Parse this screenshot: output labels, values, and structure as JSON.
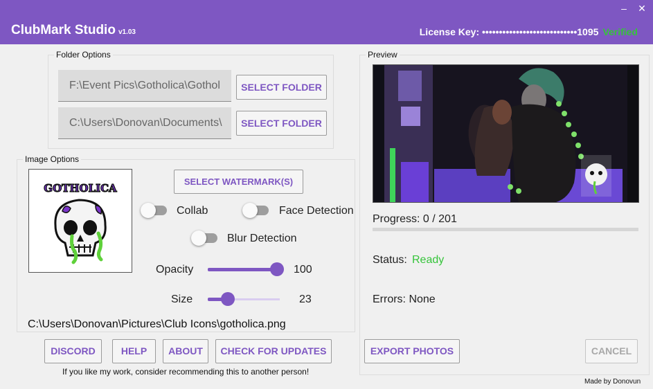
{
  "window": {
    "title": "ClubMark Studio",
    "version": "v1.03",
    "minimize_glyph": "–",
    "close_glyph": "✕",
    "license_label": "License Key:",
    "license_value": "••••••••••••••••••••••••••••1095",
    "license_status": "Verified",
    "accent_color": "#7e57c2",
    "verified_color": "#35c43a"
  },
  "folder_options": {
    "label": "Folder Options",
    "input_path": "F:\\Event Pics\\Gotholica\\Gothol",
    "output_path": "C:\\Users\\Donovan\\Documents\\",
    "select_folder_label": "SELECT FOLDER"
  },
  "image_options": {
    "label": "Image Options",
    "select_watermark_label": "SELECT WATERMARK(S)",
    "collab_label": "Collab",
    "collab_on": false,
    "face_detection_label": "Face Detection",
    "face_detection_on": false,
    "blur_detection_label": "Blur Detection",
    "blur_detection_on": false,
    "opacity_label": "Opacity",
    "opacity_value": "100",
    "opacity_fraction": 1.0,
    "size_label": "Size",
    "size_value": "23",
    "size_fraction": 0.23,
    "watermark_path": "C:\\Users\\Donovan\\Pictures\\Club Icons\\gotholica.png",
    "watermark_logo_text": "GOTHOLICA"
  },
  "buttons": {
    "discord": "DISCORD",
    "help": "HELP",
    "about": "ABOUT",
    "check_updates": "CHECK FOR UPDATES",
    "export": "EXPORT PHOTOS",
    "cancel": "CANCEL"
  },
  "footer_note": "If you like my work, consider recommending this to another person!",
  "made_by": "Made by Donovun",
  "preview": {
    "label": "Preview",
    "progress_label": "Progress: 0 / 201",
    "progress_fraction": 0,
    "status_label": "Status:",
    "status_value": "Ready",
    "errors_label": "Errors: None"
  }
}
